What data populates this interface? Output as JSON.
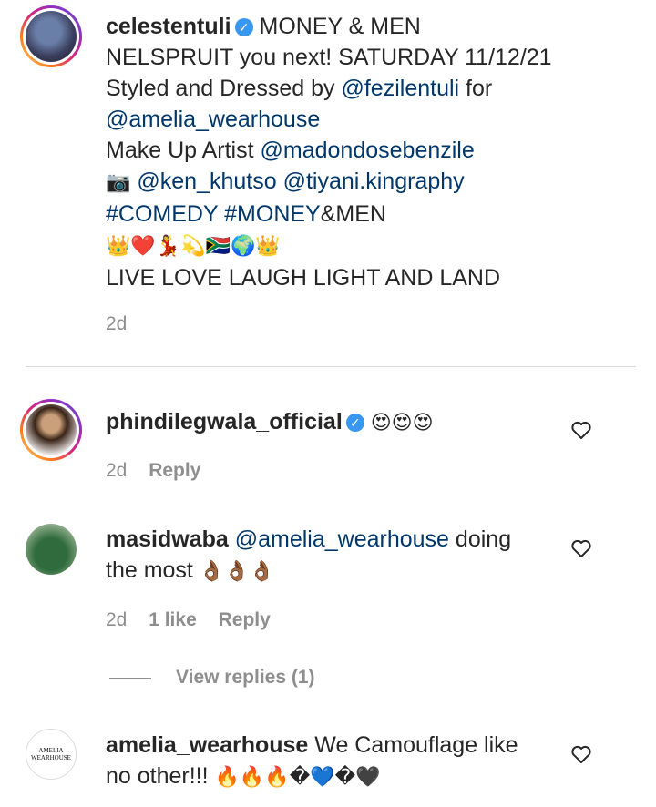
{
  "caption": {
    "username": "celestentuli",
    "lines": [
      "MONEY & MEN",
      "NELSPRUIT you next! SATURDAY 11/12/21",
      "Styled and Dressed by",
      "@fezilentuli",
      "for",
      "@amelia_wearhouse",
      "Make Up Artist",
      "@madondosebenzile",
      "📷",
      "@ken_khutso",
      "@tiyani.kingraphy",
      "#COMEDY",
      "#MONEY",
      "&MEN",
      "👑❤️💃💫🇿🇦🌍👑",
      "LIVE LOVE LAUGH LIGHT AND LAND"
    ],
    "time": "2d"
  },
  "comments": [
    {
      "username": "phindilegwala_official",
      "text": "😍😍😍",
      "time": "2d",
      "reply": "Reply"
    },
    {
      "username": "masidwaba",
      "mention": "@amelia_wearhouse",
      "text1": "doing",
      "text2": "the most",
      "emoji": "👌🏾👌🏾👌🏾",
      "time": "2d",
      "likes": "1 like",
      "reply": "Reply",
      "view_replies": "View replies (1)"
    },
    {
      "username": "amelia_wearhouse",
      "text1": "We Camouflage like",
      "text2": "no other!!!",
      "emoji": "🔥🔥🔥�💙�🖤",
      "avatar_logo": "AMELIA WEARHOUSE"
    }
  ],
  "icons": {
    "verified": "verified-badge-icon",
    "heart": "heart-outline-icon"
  },
  "colors": {
    "link": "#00376b",
    "verified": "#3897f0",
    "meta": "#8e8e8e"
  }
}
